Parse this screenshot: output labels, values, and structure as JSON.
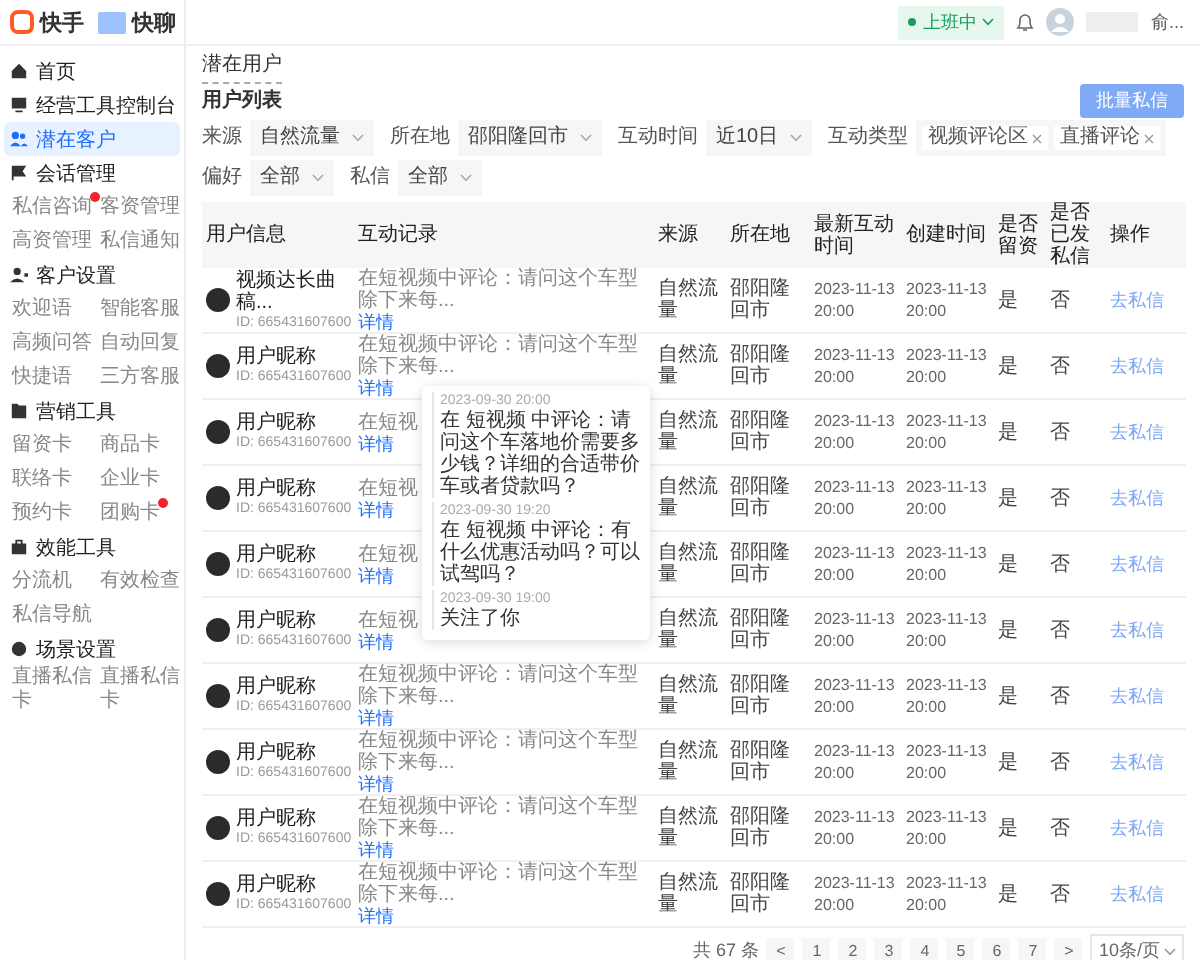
{
  "brand": {
    "logo": "快手",
    "app": "快聊"
  },
  "status": {
    "label": "上班中"
  },
  "user": {
    "name": "俞..."
  },
  "sidebar": [
    {
      "label": "首页",
      "selected": false
    },
    {
      "label": "经营工具控制台",
      "selected": false
    },
    {
      "label": "潜在客户",
      "selected": true
    },
    {
      "label": "会话管理",
      "selected": false,
      "children": [
        {
          "label": "私信咨询",
          "dot": true
        },
        {
          "label": "客资管理",
          "dot": false
        },
        {
          "label": "高资管理",
          "dot": false
        },
        {
          "label": "私信通知",
          "dot": false
        }
      ]
    },
    {
      "label": "客户设置",
      "selected": false,
      "children": [
        {
          "label": "欢迎语",
          "dot": false
        },
        {
          "label": "智能客服",
          "dot": false
        },
        {
          "label": "高频问答",
          "dot": false
        },
        {
          "label": "自动回复",
          "dot": false
        },
        {
          "label": "快捷语",
          "dot": false
        },
        {
          "label": "三方客服",
          "dot": false
        }
      ]
    },
    {
      "label": "营销工具",
      "selected": false,
      "children": [
        {
          "label": "留资卡",
          "dot": false
        },
        {
          "label": "商品卡",
          "dot": false
        },
        {
          "label": "联络卡",
          "dot": false
        },
        {
          "label": "企业卡",
          "dot": false
        },
        {
          "label": "预约卡",
          "dot": false
        },
        {
          "label": "团购卡",
          "dot": true
        }
      ]
    },
    {
      "label": "效能工具",
      "selected": false,
      "children": [
        {
          "label": "分流机",
          "dot": false
        },
        {
          "label": "有效检查",
          "dot": false
        },
        {
          "label": "私信导航",
          "dot": false
        }
      ]
    },
    {
      "label": "场景设置",
      "selected": false,
      "children": [
        {
          "label": "直播私信卡",
          "dot": false
        },
        {
          "label": "直播私信卡",
          "dot": false
        }
      ]
    }
  ],
  "page_title": "潜在用户",
  "section_title": "用户列表",
  "bulk_button": "批量私信",
  "filters": [
    {
      "label": "来源",
      "kind": "select",
      "value": "自然流量"
    },
    {
      "label": "所在地",
      "kind": "select",
      "value": "邵阳隆回市"
    },
    {
      "label": "互动时间",
      "kind": "select",
      "value": "近10日"
    },
    {
      "label": "互动类型",
      "kind": "tags",
      "tags": [
        "视频评论区",
        "直播评论"
      ]
    },
    {
      "label": "偏好",
      "kind": "select",
      "value": "全部"
    },
    {
      "label": "私信",
      "kind": "select",
      "value": "全部"
    }
  ],
  "table": {
    "columns": [
      "用户信息",
      "互动记录",
      "来源",
      "所在地",
      "最新互动时间",
      "创建时间",
      "是否留资",
      "是否已发私信",
      "操作"
    ],
    "rows": [
      {
        "name": "视频达长曲稿...",
        "id": "ID: 665431607600",
        "record": "在短视频中评论：请问这个车型除下来每...",
        "detail": "详情",
        "source": "自然流量",
        "location": "邵阳隆回市",
        "latest_date": "2023-11-13",
        "latest_time": "20:00",
        "created_date": "2023-11-13",
        "created_time": "20:00",
        "leads": "是",
        "messaged": "否",
        "action": "去私信"
      },
      {
        "name": "用户昵称",
        "id": "ID: 665431607600",
        "record": "在短视频中评论：请问这个车型除下来每...",
        "detail": "详情",
        "source": "自然流量",
        "location": "邵阳隆回市",
        "latest_date": "2023-11-13",
        "latest_time": "20:00",
        "created_date": "2023-11-13",
        "created_time": "20:00",
        "leads": "是",
        "messaged": "否",
        "action": "去私信"
      },
      {
        "name": "用户昵称",
        "id": "ID: 665431607600",
        "record": "在短视",
        "detail": "详情",
        "source": "自然流量",
        "location": "邵阳隆回市",
        "latest_date": "2023-11-13",
        "latest_time": "20:00",
        "created_date": "2023-11-13",
        "created_time": "20:00",
        "leads": "是",
        "messaged": "否",
        "action": "去私信"
      },
      {
        "name": "用户昵称",
        "id": "ID: 665431607600",
        "record": "在短视",
        "detail": "详情",
        "source": "自然流量",
        "location": "邵阳隆回市",
        "latest_date": "2023-11-13",
        "latest_time": "20:00",
        "created_date": "2023-11-13",
        "created_time": "20:00",
        "leads": "是",
        "messaged": "否",
        "action": "去私信"
      },
      {
        "name": "用户昵称",
        "id": "ID: 665431607600",
        "record": "在短视",
        "detail": "详情",
        "source": "自然流量",
        "location": "邵阳隆回市",
        "latest_date": "2023-11-13",
        "latest_time": "20:00",
        "created_date": "2023-11-13",
        "created_time": "20:00",
        "leads": "是",
        "messaged": "否",
        "action": "去私信"
      },
      {
        "name": "用户昵称",
        "id": "ID: 665431607600",
        "record": "在短视",
        "detail": "详情",
        "source": "自然流量",
        "location": "邵阳隆回市",
        "latest_date": "2023-11-13",
        "latest_time": "20:00",
        "created_date": "2023-11-13",
        "created_time": "20:00",
        "leads": "是",
        "messaged": "否",
        "action": "去私信"
      },
      {
        "name": "用户昵称",
        "id": "ID: 665431607600",
        "record": "在短视频中评论：请问这个车型除下来每...",
        "detail": "详情",
        "source": "自然流量",
        "location": "邵阳隆回市",
        "latest_date": "2023-11-13",
        "latest_time": "20:00",
        "created_date": "2023-11-13",
        "created_time": "20:00",
        "leads": "是",
        "messaged": "否",
        "action": "去私信"
      },
      {
        "name": "用户昵称",
        "id": "ID: 665431607600",
        "record": "在短视频中评论：请问这个车型除下来每...",
        "detail": "详情",
        "source": "自然流量",
        "location": "邵阳隆回市",
        "latest_date": "2023-11-13",
        "latest_time": "20:00",
        "created_date": "2023-11-13",
        "created_time": "20:00",
        "leads": "是",
        "messaged": "否",
        "action": "去私信"
      },
      {
        "name": "用户昵称",
        "id": "ID: 665431607600",
        "record": "在短视频中评论：请问这个车型除下来每...",
        "detail": "详情",
        "source": "自然流量",
        "location": "邵阳隆回市",
        "latest_date": "2023-11-13",
        "latest_time": "20:00",
        "created_date": "2023-11-13",
        "created_time": "20:00",
        "leads": "是",
        "messaged": "否",
        "action": "去私信"
      },
      {
        "name": "用户昵称",
        "id": "ID: 665431607600",
        "record": "在短视频中评论：请问这个车型除下来每...",
        "detail": "详情",
        "source": "自然流量",
        "location": "邵阳隆回市",
        "latest_date": "2023-11-13",
        "latest_time": "20:00",
        "created_date": "2023-11-13",
        "created_time": "20:00",
        "leads": "是",
        "messaged": "否",
        "action": "去私信"
      }
    ]
  },
  "popover": {
    "entries": [
      {
        "time": "2023-09-30 20:00",
        "text": "在 短视频 中评论：请问这个车落地价需要多少钱？详细的合适带价车或者贷款吗？"
      },
      {
        "time": "2023-09-30 19:20",
        "text": "在 短视频 中评论：有什么优惠活动吗？可以试驾吗？"
      },
      {
        "time": "2023-09-30 19:00",
        "text": "关注了你"
      }
    ]
  },
  "pagination": {
    "total": "共 67 条",
    "prev": "<",
    "pages": [
      "1",
      "2",
      "3",
      "4",
      "5",
      "6",
      "7"
    ],
    "next": ">",
    "size": "10条/页"
  }
}
